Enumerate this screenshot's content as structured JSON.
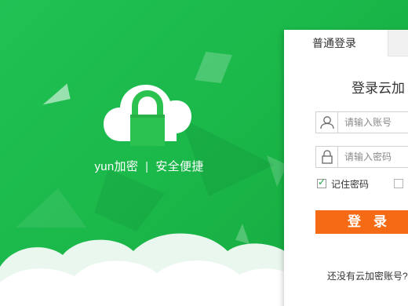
{
  "brand": {
    "name": "yun加密",
    "separator": "|",
    "slogan": "安全便捷"
  },
  "login": {
    "tabs": [
      {
        "label": "普通登录",
        "active": true
      },
      {
        "label": "",
        "active": false
      }
    ],
    "title": "登录云加",
    "username": {
      "placeholder": "请输入账号",
      "value": ""
    },
    "password": {
      "placeholder": "请输入密码",
      "value": ""
    },
    "remember_label": "记住密码",
    "remember_checked": true,
    "second_checkbox_checked": false,
    "submit_label": "登录",
    "register_text": "还没有云加密账号?"
  },
  "colors": {
    "background": "#1bb84a",
    "accent_button": "#f56a14",
    "lock_green": "#2cc24f",
    "white": "#ffffff"
  },
  "icons": {
    "logo": "cloud-lock-icon",
    "username": "user-icon",
    "password": "lock-icon"
  }
}
